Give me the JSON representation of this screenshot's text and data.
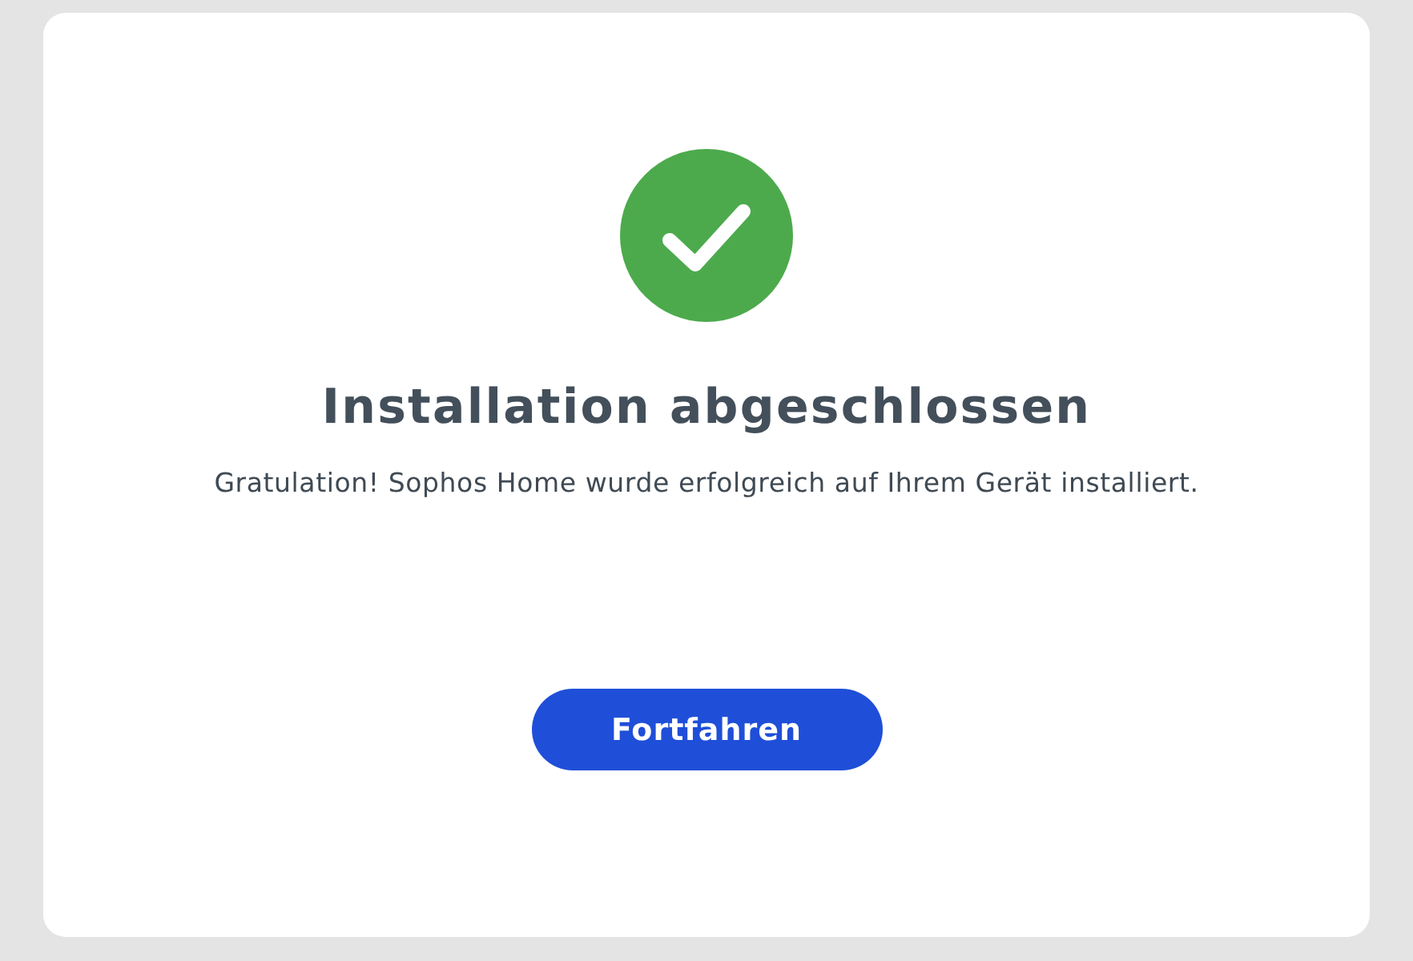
{
  "dialog": {
    "title": "Installation abgeschlossen",
    "message": "Gratulation! Sophos Home wurde erfolgreich auf Ihrem Gerät installiert.",
    "button": {
      "label": "Fortfahren"
    }
  }
}
